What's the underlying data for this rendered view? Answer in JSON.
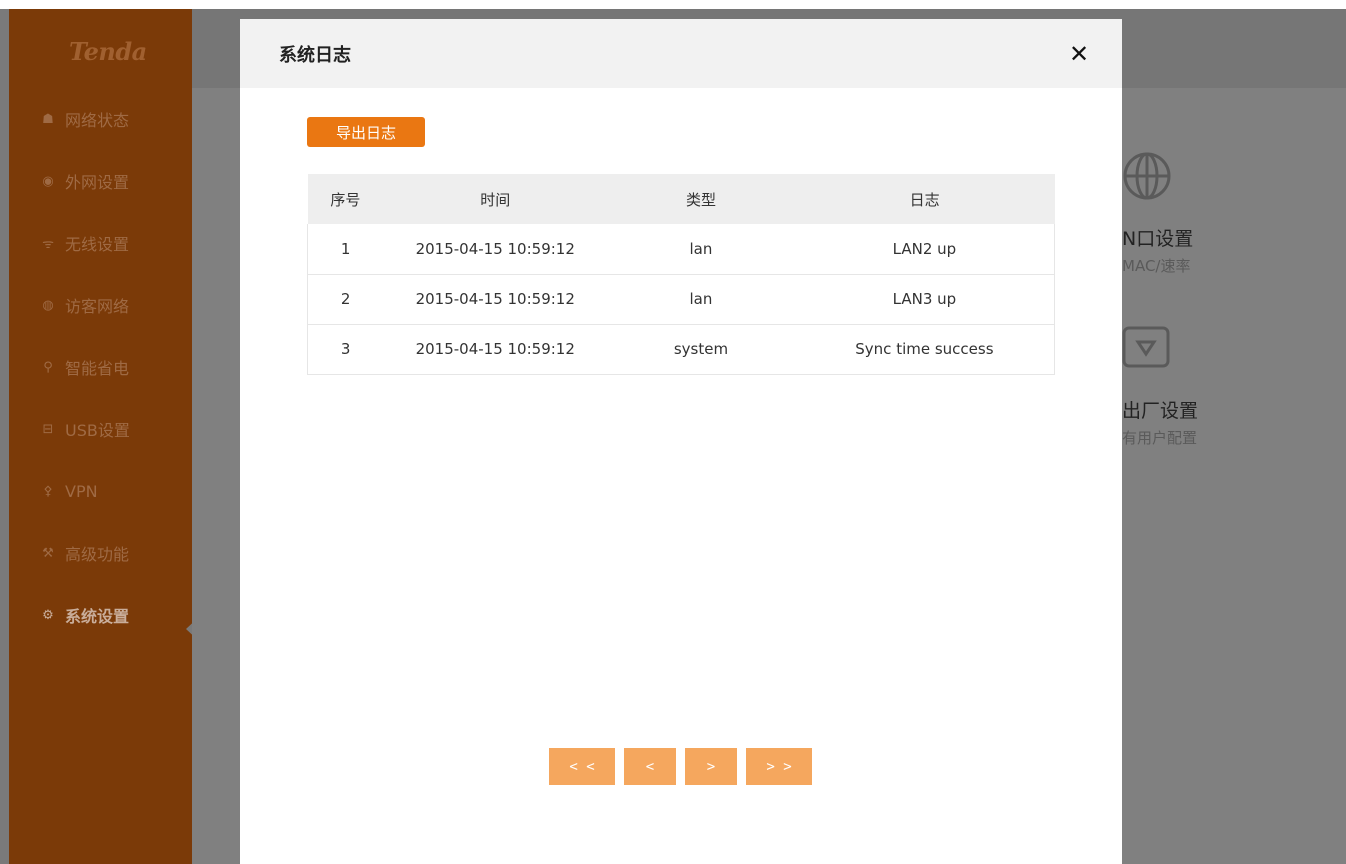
{
  "brand": "Tenda",
  "sidebar": {
    "items": [
      {
        "icon": "network-status-icon",
        "glyph": "☗",
        "label": "网络状态"
      },
      {
        "icon": "wan-settings-icon",
        "glyph": "◉",
        "label": "外网设置"
      },
      {
        "icon": "wifi-icon",
        "glyph": "ᯤ",
        "label": "无线设置"
      },
      {
        "icon": "guest-network-icon",
        "glyph": "◍",
        "label": "访客网络"
      },
      {
        "icon": "power-save-icon",
        "glyph": "⚲",
        "label": "智能省电"
      },
      {
        "icon": "usb-icon",
        "glyph": "⊟",
        "label": "USB设置"
      },
      {
        "icon": "vpn-icon",
        "glyph": "⚴",
        "label": "VPN"
      },
      {
        "icon": "advanced-icon",
        "glyph": "⚒",
        "label": "高级功能"
      },
      {
        "icon": "system-settings-icon",
        "glyph": "⚙",
        "label": "系统设置",
        "active": true
      }
    ]
  },
  "background": {
    "card1": {
      "title": "N口设置",
      "subtitle": "MAC/速率"
    },
    "card2": {
      "title": "出厂设置",
      "subtitle": "有用户配置"
    }
  },
  "modal": {
    "title": "系统日志",
    "close_label": "✕",
    "export_label": "导出日志",
    "table": {
      "headers": [
        "序号",
        "时间",
        "类型",
        "日志"
      ],
      "rows": [
        [
          "1",
          "2015-04-15 10:59:12",
          "lan",
          "LAN2 up"
        ],
        [
          "2",
          "2015-04-15 10:59:12",
          "lan",
          "LAN3 up"
        ],
        [
          "3",
          "2015-04-15 10:59:12",
          "system",
          "Sync time success"
        ]
      ]
    },
    "pager": {
      "first": "< <",
      "prev": "<",
      "next": ">",
      "last": "> >"
    }
  },
  "colors": {
    "accent": "#ea7712",
    "pager": "#f5a75e",
    "sidebar_dim": "#7b3a08",
    "overlay": "#808080"
  }
}
